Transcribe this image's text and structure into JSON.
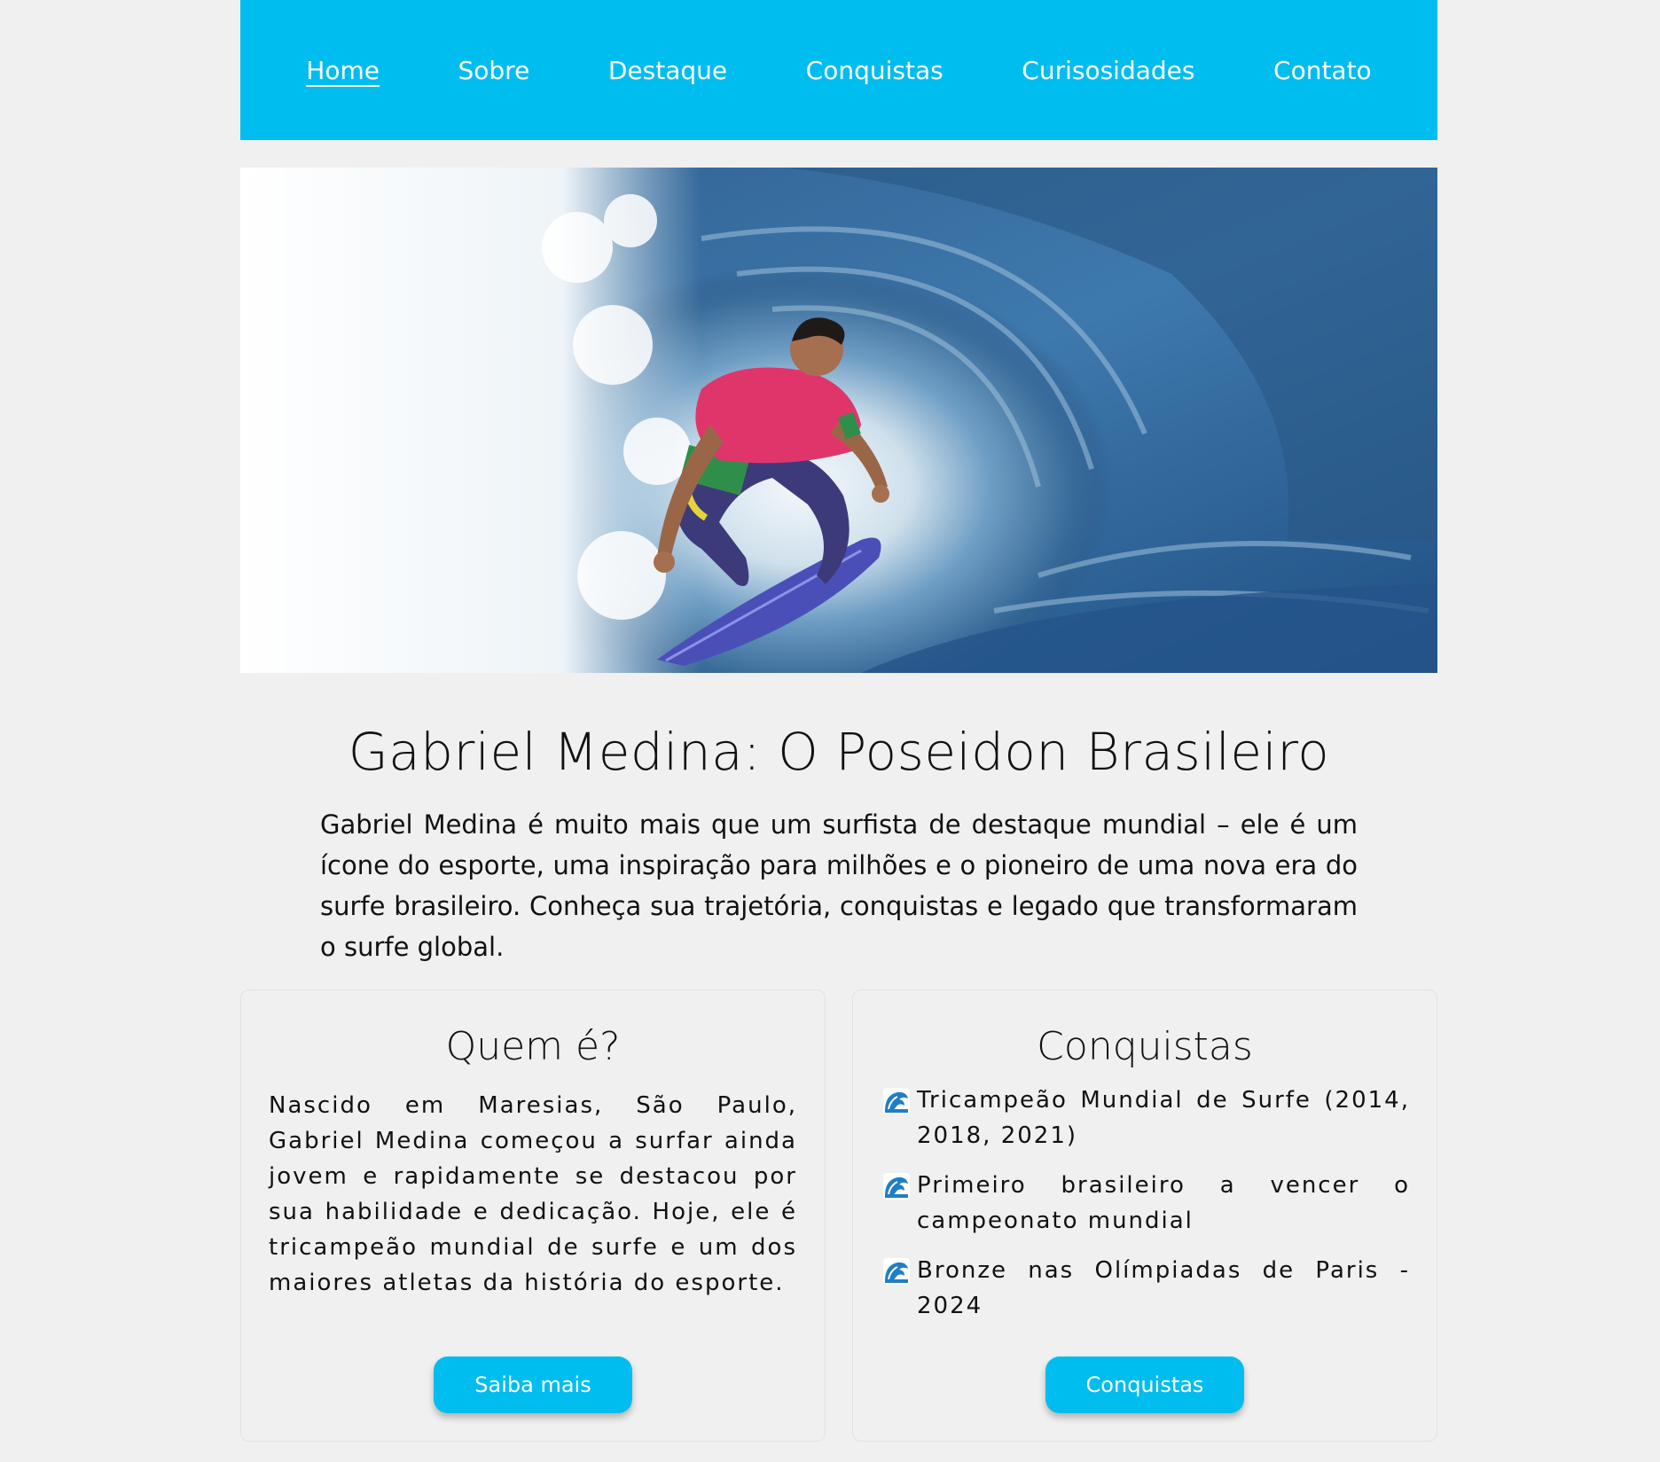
{
  "nav": {
    "items": [
      {
        "label": "Home",
        "active": true
      },
      {
        "label": "Sobre",
        "active": false
      },
      {
        "label": "Destaque",
        "active": false
      },
      {
        "label": "Conquistas",
        "active": false
      },
      {
        "label": "Curisosidades",
        "active": false
      },
      {
        "label": "Contato",
        "active": false
      }
    ]
  },
  "hero": {
    "alt": "Gabriel Medina surfando dentro de um tubo"
  },
  "main": {
    "title": "Gabriel Medina: O Poseidon Brasileiro",
    "intro": "Gabriel Medina é muito mais que um surfista de destaque mundial – ele é um ícone do esporte, uma inspiração para milhões e o pioneiro de uma nova era do surfe brasileiro. Conheça sua trajetória, conquistas e legado que transformaram o surfe global."
  },
  "about_card": {
    "title": "Quem é?",
    "text": "Nascido em Maresias, São Paulo, Gabriel Medina começou a surfar ainda jovem e rapidamente se destacou por sua habilidade e dedicação. Hoje, ele é tricampeão mundial de surfe e um dos maiores atletas da história do esporte.",
    "button_label": "Saiba mais"
  },
  "achievements_card": {
    "title": "Conquistas",
    "items": [
      {
        "icon": "wave-icon",
        "text": "Tricampeão Mundial de Surfe (2014, 2018, 2021)"
      },
      {
        "icon": "wave-icon",
        "text": "Primeiro brasileiro a vencer o campeonato mundial"
      },
      {
        "icon": "wave-icon",
        "text": "Bronze nas Olímpiadas de Paris - 2024"
      }
    ],
    "button_label": "Conquistas"
  },
  "colors": {
    "accent": "#00bdf0",
    "background": "#f0f0f0",
    "text": "#111111"
  }
}
